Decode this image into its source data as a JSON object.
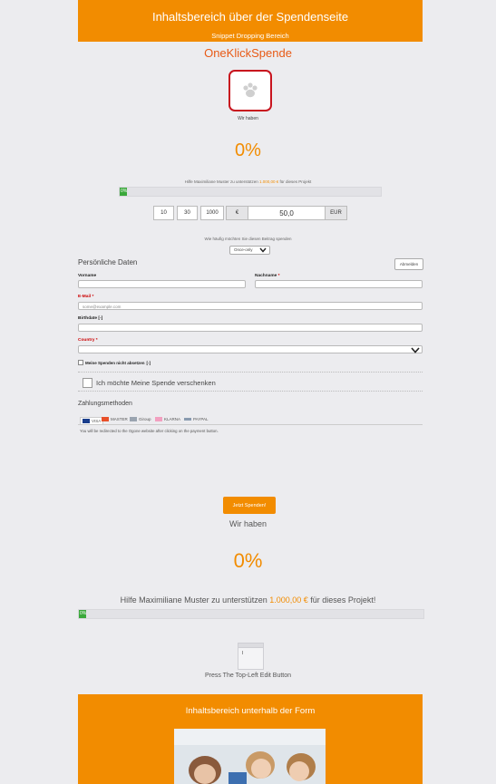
{
  "top_banner": {
    "heading": "Inhaltsbereich über der Spendenseite",
    "sub": "Snippet Dropping Bereich"
  },
  "title": "OneKlickSpende",
  "logo_caption": "Wir haben",
  "percent_top": "0%",
  "help_text": {
    "prefix": "Hilfe Maximiliane Muster zu unterstützen",
    "amount": "1.000,00 €",
    "suffix": "für dieses Projekt"
  },
  "progress_top": {
    "label": "0%",
    "value": 0
  },
  "amounts": [
    "10",
    "30",
    "1000"
  ],
  "currency_symbol": "€",
  "amount_value": "50,0",
  "currency_code": "EUR",
  "frequency_question": "Wie häufig möchten Sie diesen Beitrag spenden",
  "frequency_selected": "Once-only",
  "personal": {
    "heading": "Persönliche Daten",
    "logout": "Abmelden"
  },
  "fields": {
    "vorname": "Vorname",
    "nachname": "Nachname",
    "nachname_req": "*",
    "email": "E-Mail",
    "email_req": "*",
    "email_placeholder": "some@example.com",
    "birthdate": "Birthdate",
    "birthdate_suffix": "[-]",
    "country": "Country",
    "country_req": "*"
  },
  "tax_checkbox": {
    "label": "Meine Spenden nicht absetzen",
    "suffix": "[-]"
  },
  "gift_checkbox": "Ich möchte Meine Spende verschenken",
  "payment": {
    "heading": "Zahlungsmethoden",
    "methods": [
      "VISA",
      "MASTER",
      "Giroup",
      "KLARNA",
      "PAYPAL"
    ],
    "note": "You will be redirected to the Ogone website after clicking on the payment button."
  },
  "submit": "Jetzt Spenden!",
  "wir_haben": "Wir haben",
  "percent_bottom": "0%",
  "help_text_bottom": {
    "prefix": "Hilfe Maximiliane Muster zu unterstützen",
    "amount": "1.000,00 €",
    "suffix": "für dieses Projekt!"
  },
  "progress_bottom": {
    "label": "0%",
    "value": 0
  },
  "edit_hint": "Press The Top-Left Edit Button",
  "bottom_banner": {
    "heading": "Inhaltsbereich unterhalb der Form"
  },
  "colors": {
    "brand_orange": "#f28c00",
    "title_orange": "#e85a16",
    "logo_red": "#c8141e",
    "progress_green": "#3aa83a"
  }
}
